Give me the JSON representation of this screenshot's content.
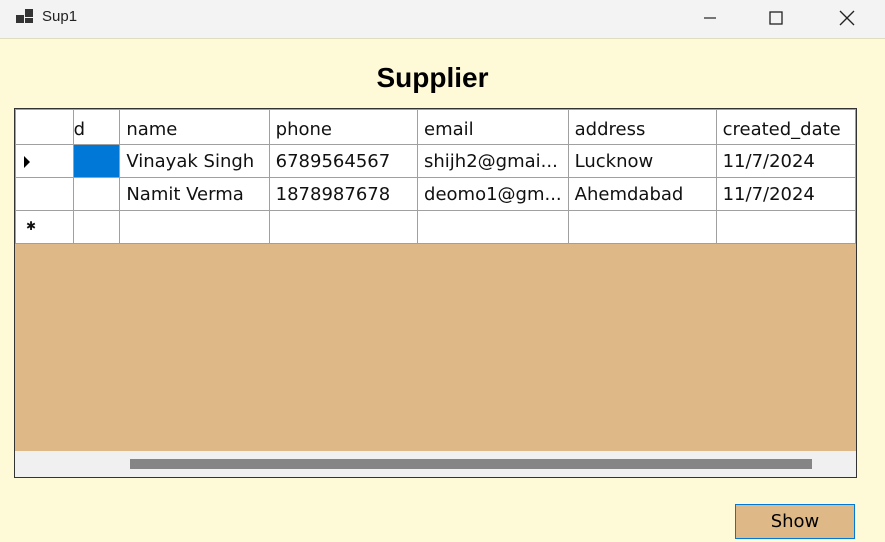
{
  "window": {
    "title": "Sup1"
  },
  "heading": "Supplier",
  "grid": {
    "columns": [
      "d",
      "name",
      "phone",
      "email",
      "address",
      "created_date"
    ],
    "rows": [
      {
        "id": "",
        "name": "Vinayak Singh",
        "phone": "6789564567",
        "email": "shijh2@gmai...",
        "address": "Lucknow",
        "created_date": "11/7/2024"
      },
      {
        "id": "",
        "name": "Namit Verma",
        "phone": "1878987678",
        "email": "deomo1@gm...",
        "address": "Ahemdabad",
        "created_date": "11/7/2024"
      }
    ]
  },
  "buttons": {
    "show": "Show"
  },
  "colors": {
    "form_bg": "#fef9d6",
    "grid_bg": "#deb887",
    "selection": "#0078d7"
  }
}
